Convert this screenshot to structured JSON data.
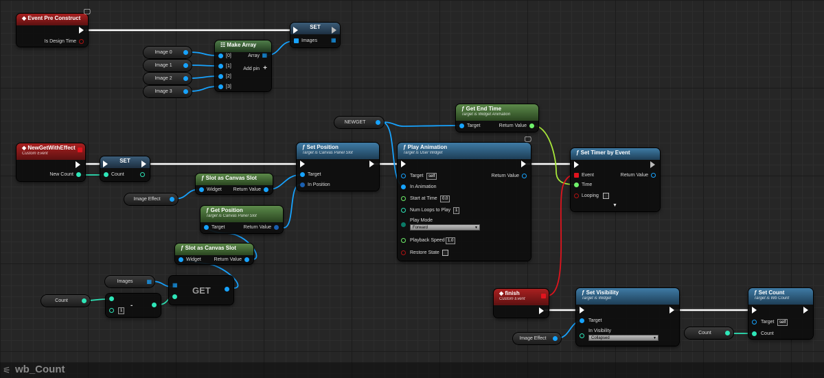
{
  "graph_title": "wb_Count",
  "event_pre_construct": {
    "title": "Event Pre Construct",
    "pin": "Is Design Time"
  },
  "set_images": {
    "title": "SET",
    "pin": "Images"
  },
  "make_array": {
    "title": "Make Array",
    "pins": [
      "[0]",
      "[1]",
      "[2]",
      "[3]"
    ],
    "output": "Array",
    "add_pin": "Add pin"
  },
  "image_vars": [
    "Image 0",
    "Image 1",
    "Image 2",
    "Image 3"
  ],
  "new_get_event": {
    "title": "NewGetWithEffect",
    "subtitle": "Custom Event",
    "pin": "New Count"
  },
  "set_count_var": {
    "title": "SET",
    "pin": "Count"
  },
  "set_position": {
    "title": "Set Position",
    "subtitle": "Target is Canvas Panel Slot",
    "pins": [
      "Target",
      "In Position"
    ]
  },
  "slot_as_canvas_1": {
    "title": "Slot as Canvas Slot",
    "in": "Widget",
    "out": "Return Value"
  },
  "image_effect_var": "Image Effect",
  "get_position": {
    "title": "Get Position",
    "subtitle": "Target is Canvas Panel Slot",
    "in": "Target",
    "out": "Return Value"
  },
  "slot_as_canvas_2": {
    "title": "Slot as Canvas Slot",
    "in": "Widget",
    "out": "Return Value"
  },
  "images_var": "Images",
  "get_node": "GET",
  "count_var": "Count",
  "subtract": {
    "op": "-",
    "value": "1"
  },
  "newget_var": "NEWGET",
  "get_end_time": {
    "title": "Get End Time",
    "subtitle": "Target is Widget Animation",
    "in": "Target",
    "out": "Return Value"
  },
  "play_animation": {
    "title": "Play Animation",
    "subtitle": "Target is User Widget",
    "target": "Target",
    "target_value": "self",
    "return": "Return Value",
    "in_animation": "In Animation",
    "start_at_time": "Start at Time",
    "start_value": "0.0",
    "num_loops": "Num Loops to Play",
    "num_loops_value": "1",
    "play_mode": "Play Mode",
    "play_mode_value": "Forward",
    "playback_speed": "Playback Speed",
    "playback_value": "1.0",
    "restore_state": "Restore State"
  },
  "set_timer": {
    "title": "Set Timer by Event",
    "event": "Event",
    "return": "Return Value",
    "time": "Time",
    "looping": "Looping"
  },
  "finish_event": {
    "title": "finish",
    "subtitle": "Custom Event"
  },
  "set_visibility": {
    "title": "Set Visibility",
    "subtitle": "Target is Widget",
    "target": "Target",
    "in_vis": "In Visibility",
    "vis_value": "Collapsed"
  },
  "image_effect_var2": "Image Effect",
  "set_count_fn": {
    "title": "Set Count",
    "subtitle": "Target is Wb Count",
    "target": "Target",
    "target_value": "self",
    "count": "Count"
  },
  "count_var2": "Count",
  "colors": {
    "exec": "#ffffff",
    "object": "#17a3ff",
    "float": "#6ff06a",
    "int": "#2ee6b8",
    "event": "#e0141e"
  }
}
